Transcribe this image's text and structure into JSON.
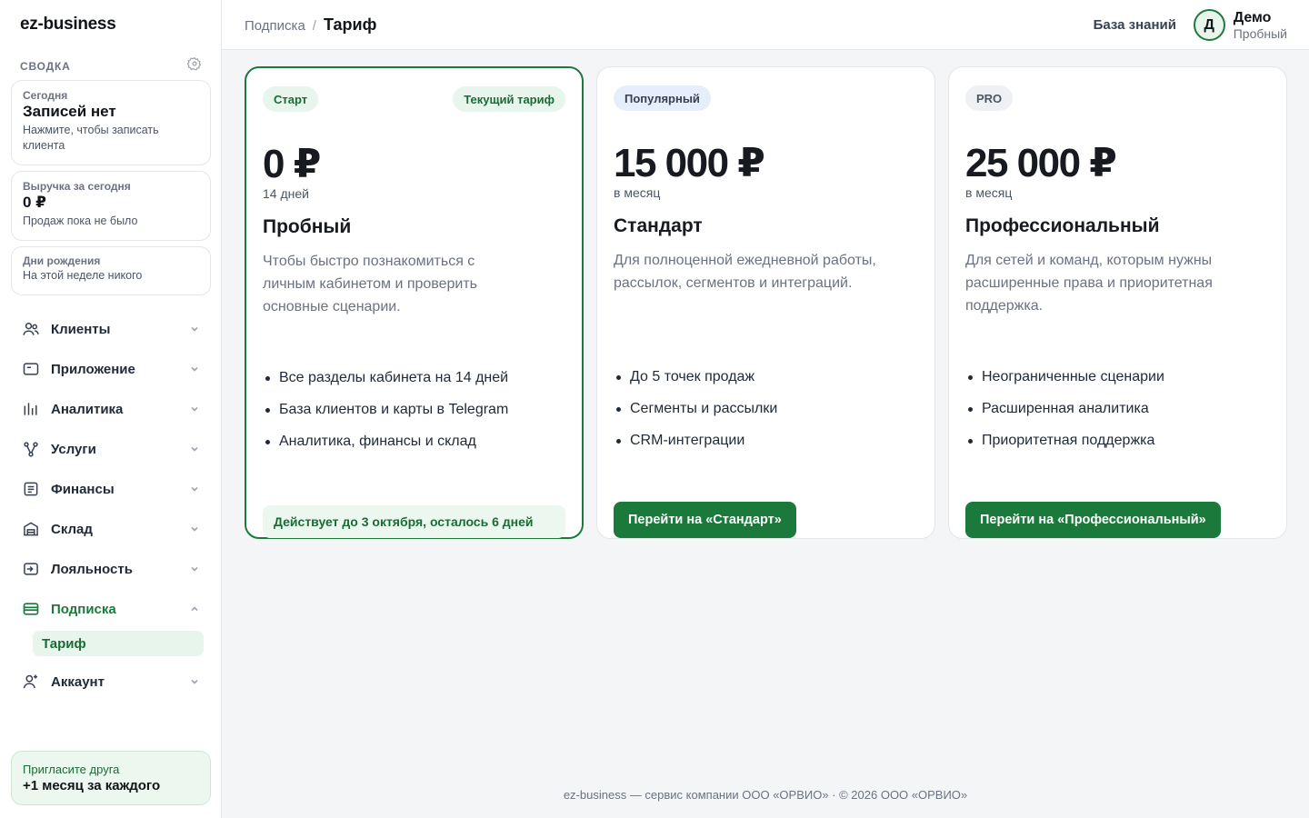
{
  "colors": {
    "accent": "#1b7a3b",
    "accent_soft": "#e8f5ec",
    "background": "#f4f5f7"
  },
  "sidebar": {
    "brand": "ez-business",
    "summary_title": "СВОДКА",
    "today": {
      "label": "Сегодня",
      "value": "Записей нет",
      "sub": "Нажмите, чтобы записать клиента"
    },
    "revenue": {
      "label": "Выручка за сегодня",
      "value": "0 ₽",
      "sub": "Продаж пока не было"
    },
    "birthdays": {
      "label": "Дни рождения",
      "sub": "На этой неделе никого"
    },
    "items": [
      {
        "label": "Клиенты",
        "icon": "users-icon"
      },
      {
        "label": "Приложение",
        "icon": "app-icon"
      },
      {
        "label": "Аналитика",
        "icon": "chart-icon"
      },
      {
        "label": "Услуги",
        "icon": "services-icon"
      },
      {
        "label": "Финансы",
        "icon": "finance-icon"
      },
      {
        "label": "Склад",
        "icon": "warehouse-icon"
      },
      {
        "label": "Лояльность",
        "icon": "loyalty-icon"
      },
      {
        "label": "Подписка",
        "icon": "card-icon"
      },
      {
        "label": "Аккаунт",
        "icon": "account-icon"
      }
    ],
    "subscription_sub": "Тариф",
    "invite": {
      "title": "Пригласите друга",
      "subtitle": "+1 месяц за каждого"
    }
  },
  "header": {
    "breadcrumb_parent": "Подписка",
    "breadcrumb_sep": "/",
    "breadcrumb_current": "Тариф",
    "knowledge_base": "База знаний",
    "user": {
      "initial": "Д",
      "name": "Демо",
      "role": "Пробный"
    }
  },
  "plans": [
    {
      "chip": "Старт",
      "badge": "Текущий тариф",
      "price": "0 ₽",
      "period": "14 дней",
      "name": "Пробный",
      "description": "Чтобы быстро познакомиться с личным кабинетом и проверить основные сценарии.",
      "features": [
        "Все разделы кабинета на 14 дней",
        "База клиентов и карты в Telegram",
        "Аналитика, финансы и склад"
      ],
      "status": "Действует до 3 октября, осталось 6 дней"
    },
    {
      "chip": "Популярный",
      "price": "15 000 ₽",
      "period": "в месяц",
      "name": "Стандарт",
      "description": "Для полноценной ежедневной работы, рассылок, сегментов и интеграций.",
      "features": [
        "До 5 точек продаж",
        "Сегменты и рассылки",
        "CRM-интеграции"
      ],
      "cta": "Перейти на «Стандарт»"
    },
    {
      "chip": "PRO",
      "price": "25 000 ₽",
      "period": "в месяц",
      "name": "Профессиональный",
      "description": "Для сетей и команд, которым нужны расширенные права и приоритетная поддержка.",
      "features": [
        "Неограниченные сценарии",
        "Расширенная аналитика",
        "Приоритетная поддержка"
      ],
      "cta": "Перейти на «Профессиональный»"
    }
  ],
  "footer": "ez-business — сервис компании ООО «ОРВИО» · © 2026 ООО «ОРВИО»"
}
